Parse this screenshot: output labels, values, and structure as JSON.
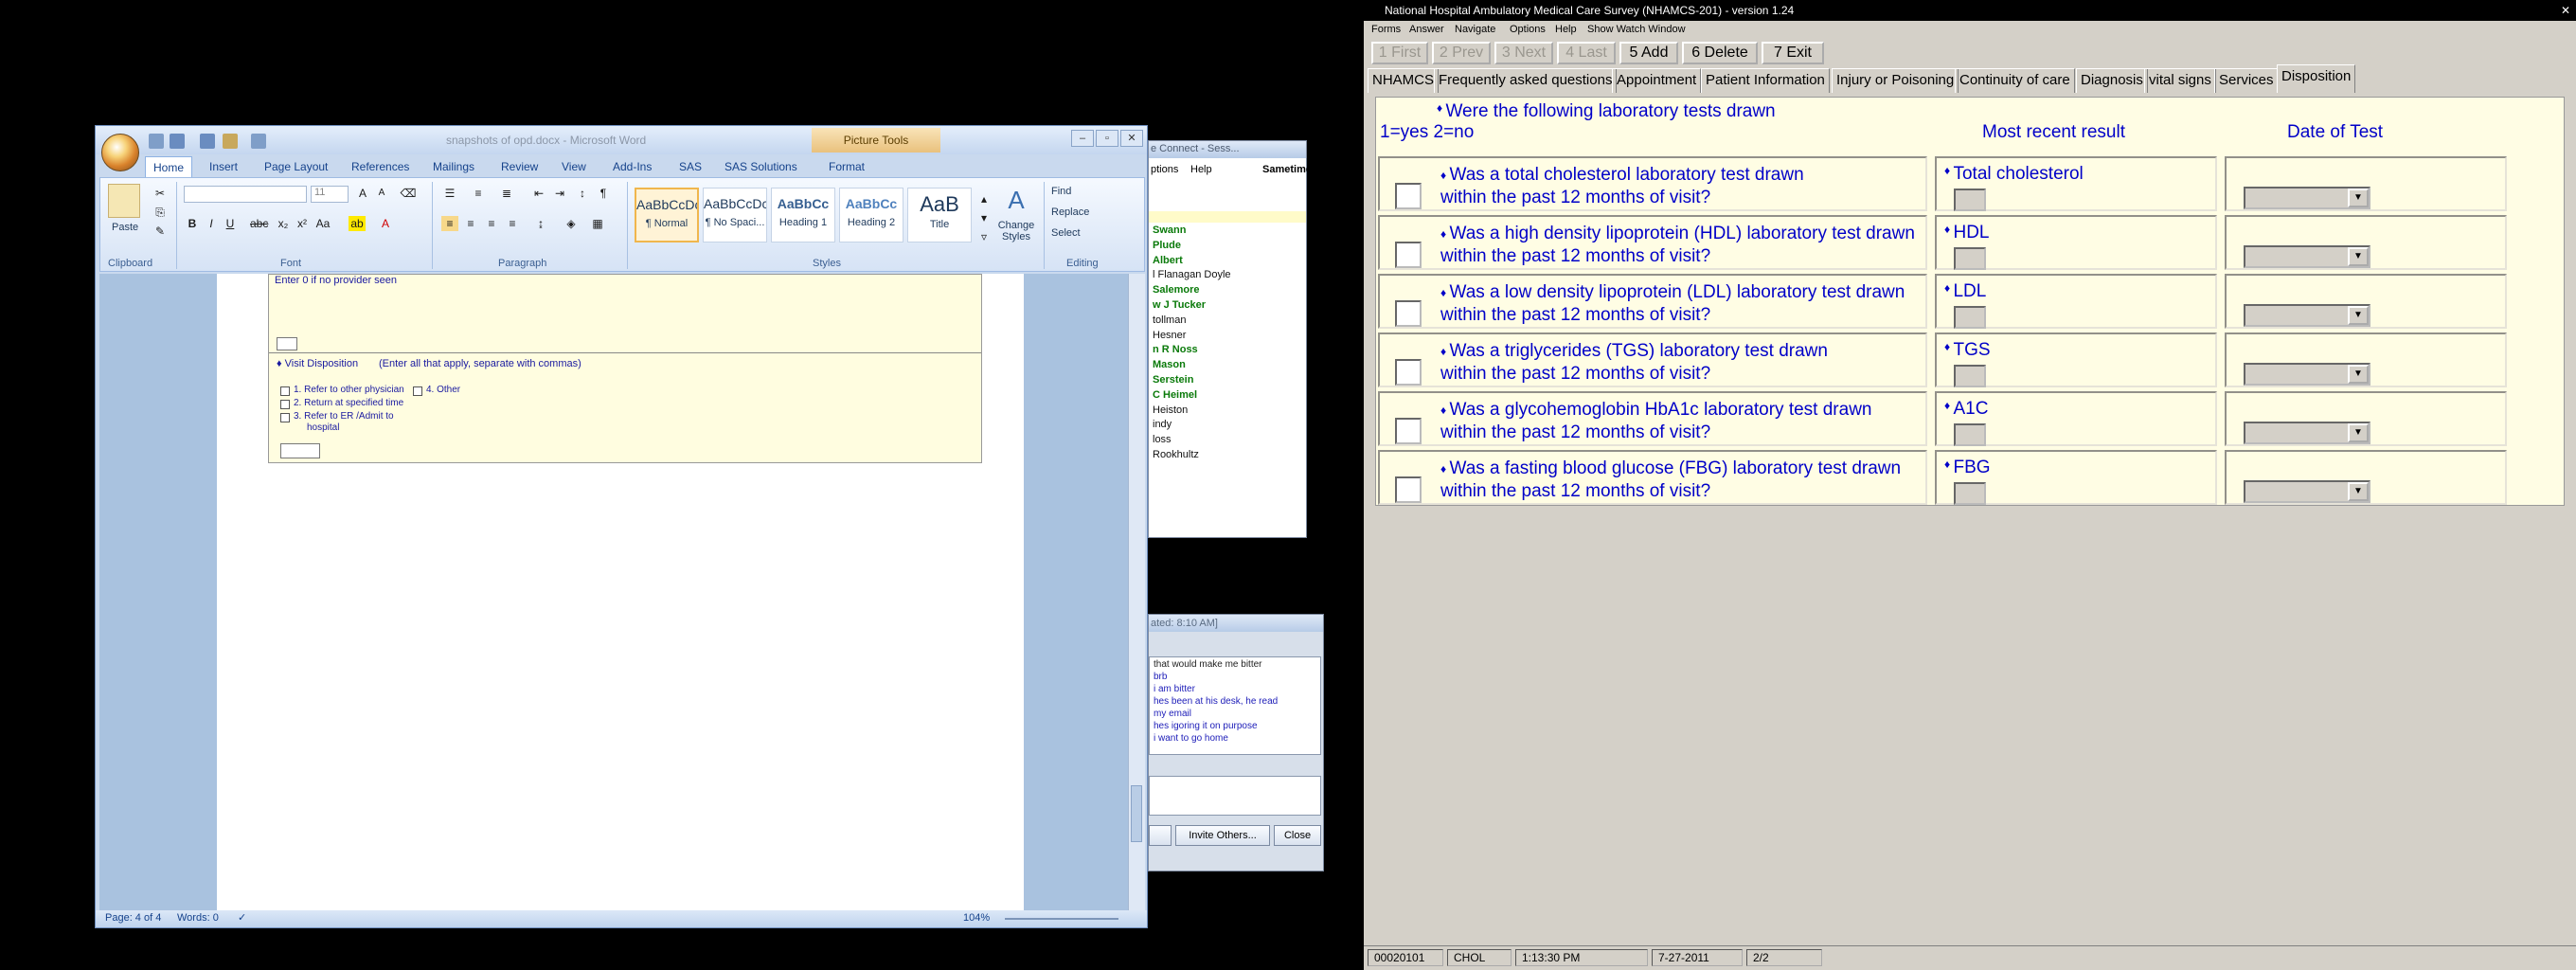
{
  "word": {
    "title": "snapshots of opd.docx - Microsoft Word",
    "picture_tools": "Picture Tools",
    "tabs": [
      "Home",
      "Insert",
      "Page Layout",
      "References",
      "Mailings",
      "Review",
      "View",
      "Add-Ins",
      "SAS",
      "SAS Solutions",
      "Format"
    ],
    "font_size": "11",
    "styles": [
      {
        "sample": "AaBbCcDc",
        "name": "¶ Normal"
      },
      {
        "sample": "AaBbCcDc",
        "name": "¶ No Spaci..."
      },
      {
        "sample": "AaBbCc",
        "name": "Heading 1"
      },
      {
        "sample": "AaBbCc",
        "name": "Heading 2"
      },
      {
        "sample": "AaB",
        "name": "Title"
      }
    ],
    "change_styles": "Change Styles",
    "editing": {
      "find": "Find",
      "replace": "Replace",
      "select": "Select"
    },
    "groups": {
      "clipboard": "Clipboard",
      "font": "Font",
      "paragraph": "Paragraph",
      "styles": "Styles",
      "editing": "Editing"
    },
    "paste": "Paste",
    "doc": {
      "top_text": "Enter 0 if no provider seen",
      "visit_title": "Visit Disposition",
      "visit_hint": "(Enter all that apply, separate with commas)",
      "options": [
        "1.  Refer to other physician",
        "2.  Return at specified time",
        "3.  Refer to ER /Admit to",
        "hospital",
        "4.  Other"
      ]
    },
    "status": {
      "page": "Page: 4 of 4",
      "words": "Words: 0",
      "zoom": "104%"
    }
  },
  "sametime": {
    "title": "e Connect - Sess...",
    "menu": [
      "ptions",
      "Help"
    ],
    "brand": "Sametime",
    "contacts": [
      {
        "name": "Swann",
        "online": true
      },
      {
        "name": "Plude",
        "online": true
      },
      {
        "name": "Albert",
        "online": true
      },
      {
        "name": "l Flanagan Doyle",
        "online": false
      },
      {
        "name": "Salemore",
        "online": true
      },
      {
        "name": "w J Tucker",
        "online": true
      },
      {
        "name": "tollman",
        "online": false
      },
      {
        "name": "Hesner",
        "online": false
      },
      {
        "name": "n R Noss",
        "online": true
      },
      {
        "name": "Mason",
        "online": true
      },
      {
        "name": "Serstein",
        "online": true
      },
      {
        "name": "C Heimel",
        "online": true
      },
      {
        "name": "Heiston",
        "online": false
      },
      {
        "name": "indy",
        "online": false
      },
      {
        "name": "loss",
        "online": false
      },
      {
        "name": "Rookhultz",
        "online": false
      }
    ]
  },
  "chat": {
    "title": "ated: 8:10 AM]",
    "messages": [
      "that would make me bitter",
      "brb",
      "i am bitter",
      "hes been at his desk, he read",
      "my email",
      "hes igoring it on purpose",
      "i want to go home"
    ],
    "invite": "Invite Others...",
    "close": "Close"
  },
  "nhamcs": {
    "title": "National Hospital Ambulatory Medical Care Survey (NHAMCS-201) - version 1.24",
    "menu": [
      "Forms",
      "Answer",
      "Navigate",
      "Options",
      "Help",
      "Show Watch Window"
    ],
    "toolbar": [
      {
        "label": "1 First",
        "enabled": false
      },
      {
        "label": "2 Prev",
        "enabled": false
      },
      {
        "label": "3 Next",
        "enabled": false
      },
      {
        "label": "4 Last",
        "enabled": false
      },
      {
        "label": "5 Add",
        "enabled": true
      },
      {
        "label": "6 Delete",
        "enabled": true
      },
      {
        "label": "7 Exit",
        "enabled": true
      }
    ],
    "tabs": [
      "NHAMCS",
      "Frequently asked questions",
      "Appointment",
      "Patient Information",
      "Injury or Poisoning",
      "Continuity of care",
      "Diagnosis",
      "vital signs",
      "Services",
      "Disposition"
    ],
    "active_tab": "Disposition",
    "header": {
      "question": "Were the following laboratory tests drawn",
      "coding": "1=yes  2=no",
      "col_result": "Most recent result",
      "col_date": "Date of Test"
    },
    "questions": [
      {
        "line1": "Was a total cholesterol laboratory test drawn",
        "line2": "within the past 12 months of visit?",
        "result": "Total cholesterol"
      },
      {
        "line1": "Was a high density lipoprotein (HDL) laboratory test drawn",
        "line2": "within the past 12 months of visit?",
        "result": "HDL"
      },
      {
        "line1": "Was a low density lipoprotein (LDL) laboratory test drawn",
        "line2": "within the past 12 months of visit?",
        "result": "LDL"
      },
      {
        "line1": "Was a triglycerides (TGS) laboratory test drawn",
        "line2": "within the past 12 months of visit?",
        "result": "TGS"
      },
      {
        "line1": "Was a glycohemoglobin HbA1c laboratory test drawn",
        "line2": "within the past 12 months of visit?",
        "result": "A1C"
      },
      {
        "line1": "Was a fasting blood glucose (FBG) laboratory test drawn",
        "line2": "within the past 12 months of visit?",
        "result": "FBG"
      }
    ],
    "status": {
      "record": "00020101",
      "field": "CHOL",
      "time": "1:13:30 PM",
      "date": "7-27-2011",
      "page": "2/2"
    }
  }
}
